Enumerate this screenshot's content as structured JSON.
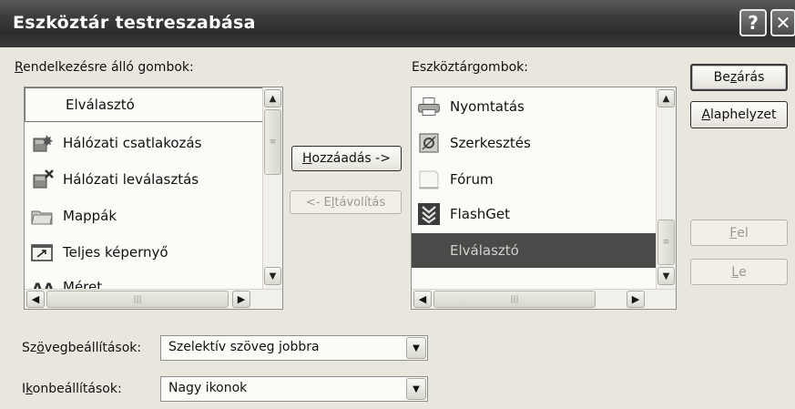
{
  "dialog": {
    "title": "Eszköztár testreszabása",
    "help_label": "?",
    "close_label": "✕"
  },
  "available": {
    "label_key": "R",
    "label_rest": "endelkezésre álló gombok:",
    "items": [
      {
        "label": "Elválasztó",
        "icon": "separator"
      },
      {
        "label": "Hálózati csatlakozás",
        "icon": "network-connect-icon"
      },
      {
        "label": "Hálózati leválasztás",
        "icon": "network-disconnect-icon"
      },
      {
        "label": "Mappák",
        "icon": "folders-icon"
      },
      {
        "label": "Teljes képernyő",
        "icon": "fullscreen-icon"
      },
      {
        "label": "Méret",
        "icon": "text-size-icon"
      }
    ]
  },
  "current": {
    "label_pre": "Eszköztár",
    "label_key": "g",
    "label_post": "ombok:",
    "items": [
      {
        "label": "Nyomtatás",
        "icon": "printer-icon"
      },
      {
        "label": "Szerkesztés",
        "icon": "edit-icon"
      },
      {
        "label": "Fórum",
        "icon": "forum-icon"
      },
      {
        "label": "FlashGet",
        "icon": "flashget-icon"
      },
      {
        "label": "Elválasztó",
        "icon": "separator"
      }
    ]
  },
  "buttons": {
    "close_pre": "Be",
    "close_key": "z",
    "close_post": "árás",
    "reset_key": "A",
    "reset_post": "laphelyzet",
    "add_key": "H",
    "add_post": "ozzáadás ->",
    "remove_pre": "<- E",
    "remove_key": "l",
    "remove_post": "távolítás",
    "up_key": "F",
    "up_post": "el",
    "down_key": "L",
    "down_post": "e"
  },
  "text_options": {
    "label_pre": "Sz",
    "label_key": "ö",
    "label_post": "vegbeállítások:",
    "value": "Szelektív szöveg jobbra"
  },
  "icon_options": {
    "label_pre": "I",
    "label_key": "k",
    "label_post": "onbeállítások:",
    "value": "Nagy ikonok"
  },
  "colors": {
    "title_bar": "#3c3c3c",
    "selection": "#4a4a48"
  }
}
